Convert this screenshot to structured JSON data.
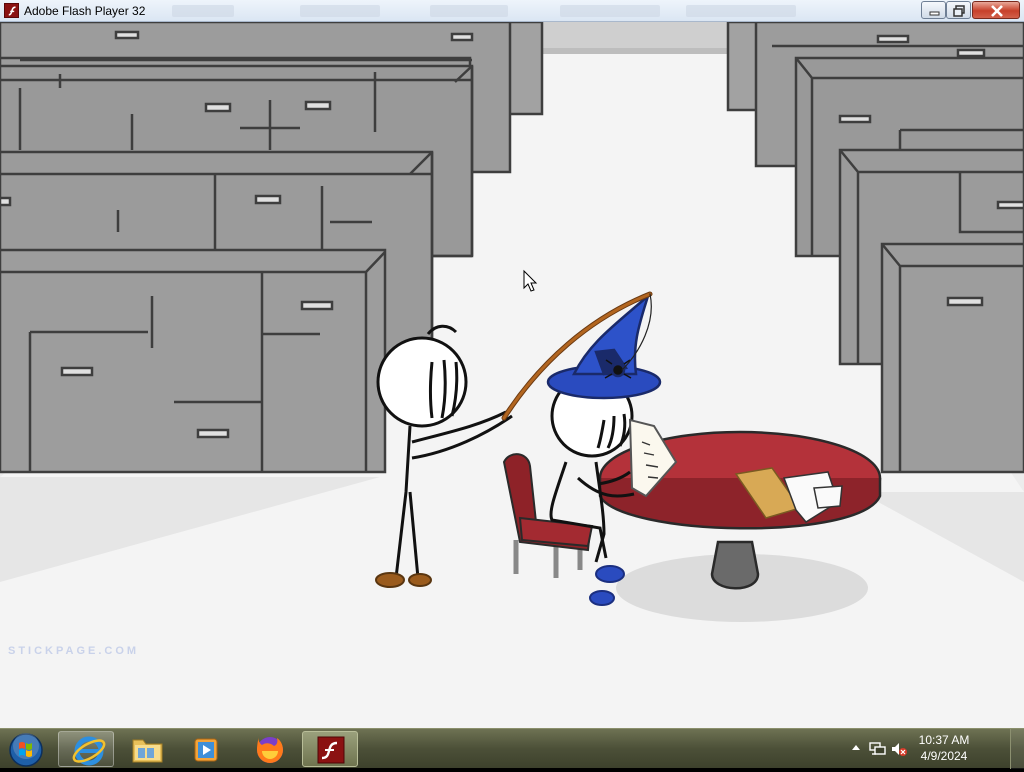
{
  "window": {
    "title": "Adobe Flash Player 32",
    "icon": "flash-player-icon",
    "controls": [
      "minimize-icon",
      "restore-icon",
      "close-icon"
    ]
  },
  "game": {
    "watermark": "STICKPAGE.COM",
    "scene": "office-cubicles",
    "characters": [
      "stickman-with-fishing-rod",
      "wizard-stickman-reading"
    ]
  },
  "taskbar": {
    "start": "windows-start-orb",
    "items": [
      {
        "name": "internet-explorer",
        "icon": "internet-explorer-icon",
        "state": "highlighted"
      },
      {
        "name": "file-explorer",
        "icon": "folder-icon",
        "state": "normal"
      },
      {
        "name": "media-player",
        "icon": "media-player-icon",
        "state": "normal"
      },
      {
        "name": "firefox",
        "icon": "firefox-icon",
        "state": "normal"
      },
      {
        "name": "flash-player",
        "icon": "flash-player-icon",
        "state": "active"
      }
    ],
    "tray": {
      "icons": [
        "show-hidden-icons-arrow",
        "network-icon",
        "volume-muted-icon"
      ],
      "time": "10:37 AM",
      "date": "4/9/2024"
    }
  },
  "colors": {
    "flash_red": "#8b1212",
    "wizard_hat": "#2a4bbf",
    "table_red": "#b8333a",
    "cabinet_gray": "#9a9a9a"
  }
}
